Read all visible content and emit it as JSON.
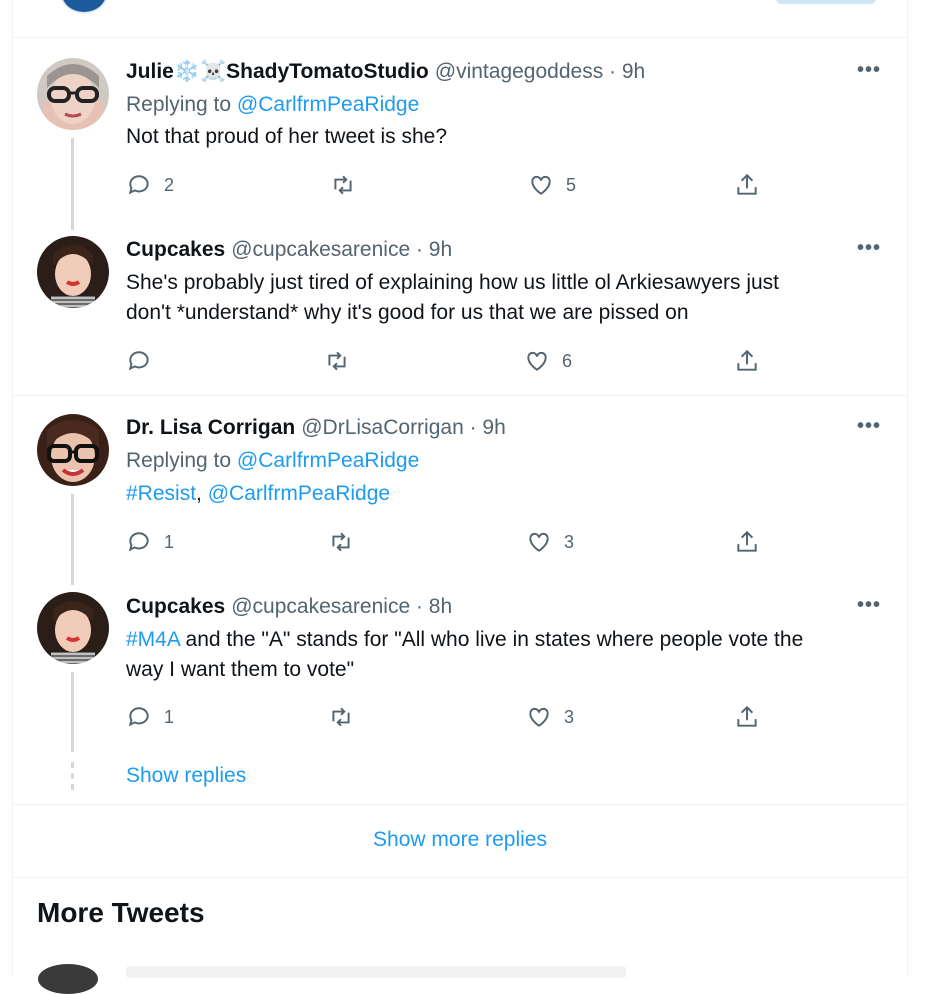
{
  "tweets": [
    {
      "name_prefix": "☠️❄️",
      "name": "Julie❄️☠️ShadyTomatoStudio",
      "handle": "@vintagegoddess · 9h",
      "replying_label": "Replying to ",
      "replying_to": "@CarlfrmPeaRidge",
      "text": "Not that proud of her tweet is she?",
      "replies": "2",
      "retweets": "",
      "likes": "5"
    },
    {
      "name": "Cupcakes",
      "handle": "@cupcakesarenice · 9h",
      "text_line1": "She's probably just tired of explaining how us little ol Arkiesawyers just",
      "text_line2": "don't *understand* why it's good for us that we are pissed on",
      "replies": "",
      "retweets": "",
      "likes": "6"
    },
    {
      "name": "Dr. Lisa Corrigan",
      "handle": "@DrLisaCorrigan · 9h",
      "replying_label": "Replying to ",
      "replying_to": "@CarlfrmPeaRidge",
      "hashtag": "#Resist",
      "comma": ",",
      "mention": "@CarlfrmPeaRidge",
      "replies": "1",
      "retweets": "",
      "likes": "3"
    },
    {
      "name": "Cupcakes",
      "handle": "@cupcakesarenice · 8h",
      "hashtag": "#M4A",
      "text_rest1": " and the \"A\" stands for \"All who live in states where people vote the",
      "text_line2": "way I want them to vote\"",
      "replies": "1",
      "retweets": "",
      "likes": "3"
    }
  ],
  "show_replies": "Show replies",
  "show_more_replies": "Show more replies",
  "more_tweets_heading": "More Tweets",
  "more_icon": "•••",
  "colors": {
    "link": "#1d9bf0",
    "secondary": "#536471",
    "text": "#0f1419",
    "border": "#eff3f4",
    "thread": "#cfd9de"
  },
  "icons": [
    "reply-icon",
    "retweet-icon",
    "like-icon",
    "share-icon",
    "more-icon"
  ]
}
